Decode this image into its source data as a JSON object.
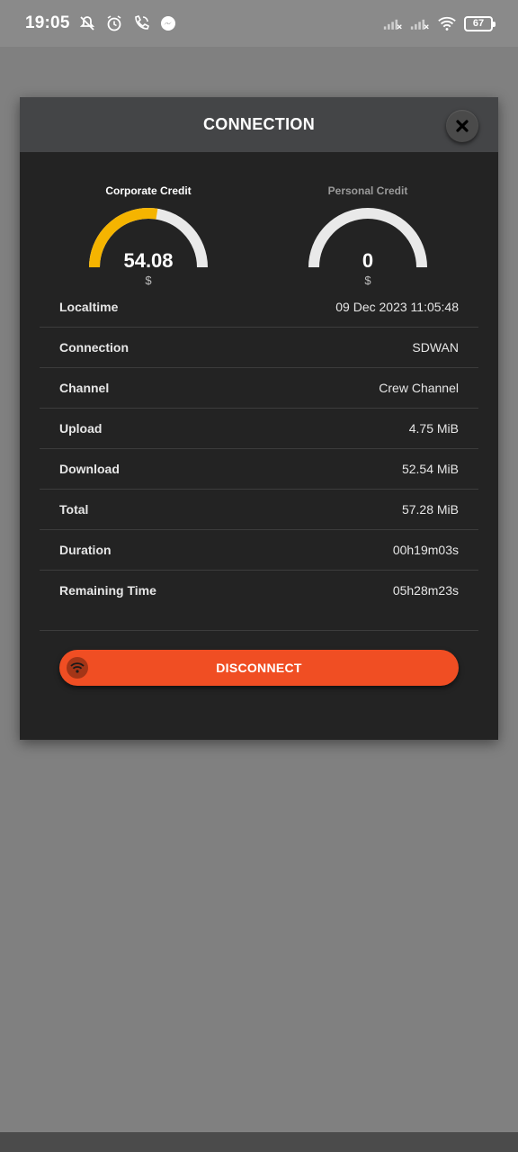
{
  "status_bar": {
    "time": "19:05",
    "battery": "67"
  },
  "modal": {
    "title": "CONNECTION",
    "close_icon": "close-icon"
  },
  "gauges": {
    "corporate": {
      "label": "Corporate Credit",
      "value": "54.08",
      "unit": "$",
      "fill_fraction": 0.55,
      "color": "#f5b400"
    },
    "personal": {
      "label": "Personal Credit",
      "value": "0",
      "unit": "$",
      "fill_fraction": 0.0,
      "color": "#f5b400"
    }
  },
  "info": {
    "rows": [
      {
        "label": "Localtime",
        "value": "09 Dec 2023 11:05:48"
      },
      {
        "label": "Connection",
        "value": "SDWAN"
      },
      {
        "label": "Channel",
        "value": "Crew Channel"
      },
      {
        "label": "Upload",
        "value": "4.75 MiB"
      },
      {
        "label": "Download",
        "value": "52.54 MiB"
      },
      {
        "label": "Total",
        "value": "57.28 MiB"
      },
      {
        "label": "Duration",
        "value": "00h19m03s"
      },
      {
        "label": "Remaining Time",
        "value": "05h28m23s"
      }
    ]
  },
  "actions": {
    "disconnect_label": "DISCONNECT",
    "disconnect_icon": "wifi-icon"
  },
  "colors": {
    "accent": "#f04e23",
    "gauge_fill": "#f5b400",
    "modal_bg": "#232323",
    "header_bg": "#444547"
  }
}
